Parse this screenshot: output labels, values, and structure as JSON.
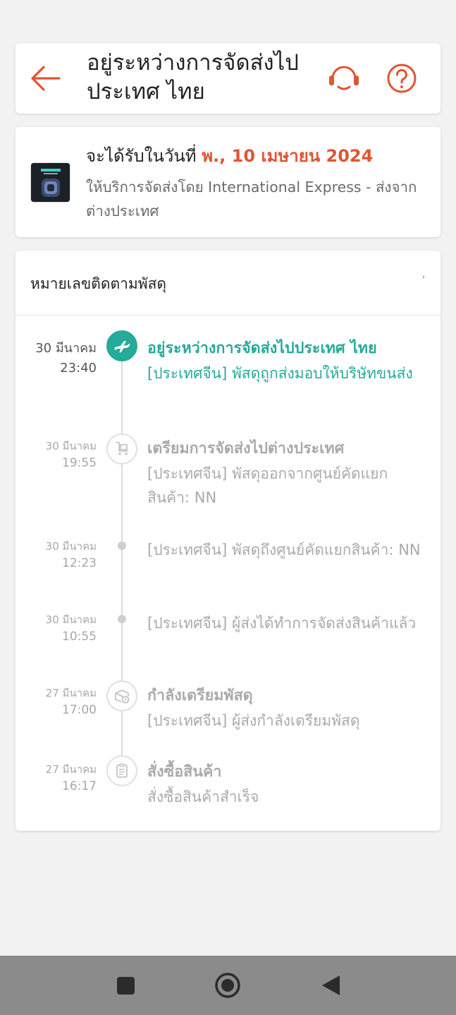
{
  "header": {
    "title": "อยู่ระหว่างการจัดส่งไปประเทศ ไทย",
    "back_icon": "arrow-left-icon",
    "support_icon": "headset-icon",
    "help_icon": "question-circle-icon"
  },
  "delivery": {
    "eta_prefix": "จะได้รับในวันที่",
    "eta_date": "พ., 10 เมษายน 2024",
    "carrier_text": "ให้บริการจัดส่งโดย International Express - ส่งจากต่างประเทศ"
  },
  "tracking": {
    "label": "หมายเลขติดตามพัสดุ",
    "number": "'",
    "events": [
      {
        "date": "30 มีนาคม",
        "time": "23:40",
        "title": "อยู่ระหว่างการจัดส่งไปประเทศ ไทย",
        "desc": "[ประเทศจีน] พัสดุถูกส่งมอบให้บริษัทขนส่ง",
        "icon": "airplane-icon"
      },
      {
        "date": "30 มีนาคม",
        "time": "19:55",
        "title": "เตรียมการจัดส่งไปต่างประเทศ",
        "desc": "[ประเทศจีน] พัสดุออกจากศูนย์คัดแยกสินค้า: NN",
        "icon": "cart-icon"
      },
      {
        "date": "30 มีนาคม",
        "time": "12:23",
        "desc": "[ประเทศจีน] พัสดุถึงศูนย์คัดแยกสินค้า: NN"
      },
      {
        "date": "30 มีนาคม",
        "time": "10:55",
        "desc": "[ประเทศจีน] ผู้ส่งได้ทำการจัดส่งสินค้าแล้ว"
      },
      {
        "date": "27 มีนาคม",
        "time": "17:00",
        "title": "กำลังเตรียมพัสดุ",
        "desc": "[ประเทศจีน] ผู้ส่งกำลังเตรียมพัสดุ",
        "icon": "package-clock-icon"
      },
      {
        "date": "27 มีนาคม",
        "time": "16:17",
        "title": "สั่งซื้อสินค้า",
        "desc": "สั่งซื้อสินค้าสำเร็จ",
        "icon": "clipboard-icon"
      }
    ]
  },
  "navbar": {
    "recents_icon": "square-icon",
    "home_icon": "home-circle-icon",
    "back_icon": "triangle-back-icon"
  },
  "colors": {
    "accent_orange": "#e05533",
    "accent_teal": "#26aa99",
    "muted_text": "#aaaaaa"
  }
}
